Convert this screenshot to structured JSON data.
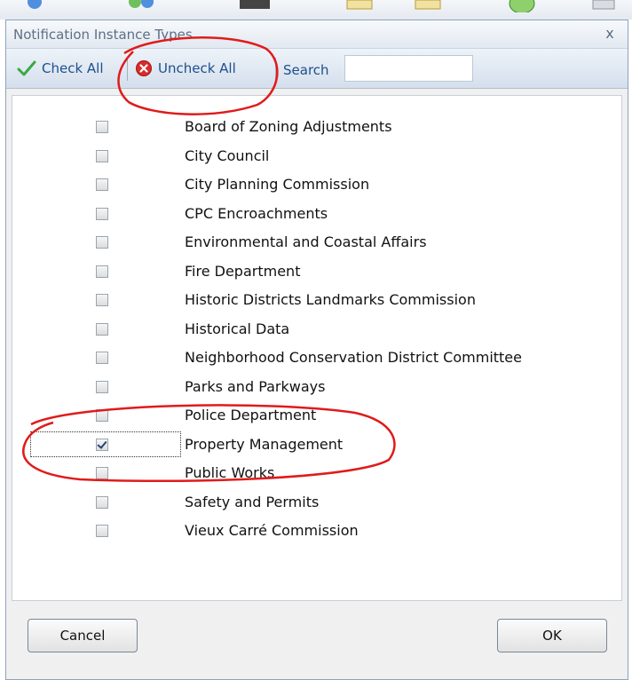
{
  "dialog": {
    "title": "Notification Instance Types",
    "close_glyph": "x"
  },
  "toolbar": {
    "check_all_label": "Check All",
    "uncheck_all_label": "Uncheck All",
    "search_label": "Search",
    "search_value": ""
  },
  "items": [
    {
      "label": "Board of Zoning Adjustments",
      "checked": false
    },
    {
      "label": "City Council",
      "checked": false
    },
    {
      "label": "City Planning Commission",
      "checked": false
    },
    {
      "label": "CPC Encroachments",
      "checked": false
    },
    {
      "label": "Environmental and Coastal Affairs",
      "checked": false
    },
    {
      "label": "Fire Department",
      "checked": false
    },
    {
      "label": "Historic Districts Landmarks Commission",
      "checked": false
    },
    {
      "label": "Historical Data",
      "checked": false
    },
    {
      "label": "Neighborhood Conservation District Committee",
      "checked": false
    },
    {
      "label": "Parks and Parkways",
      "checked": false
    },
    {
      "label": "Police Department",
      "checked": false
    },
    {
      "label": "Property Management",
      "checked": true,
      "focused": true
    },
    {
      "label": "Public Works",
      "checked": false
    },
    {
      "label": "Safety and Permits",
      "checked": false
    },
    {
      "label": "Vieux Carré Commission",
      "checked": false
    }
  ],
  "buttons": {
    "cancel_label": "Cancel",
    "ok_label": "OK"
  },
  "icons": {
    "check_all": "green-checkmark-icon",
    "uncheck_all": "red-x-circle-icon"
  },
  "colors": {
    "annotation": "#e01b1b",
    "link_text": "#1d4f8c"
  }
}
